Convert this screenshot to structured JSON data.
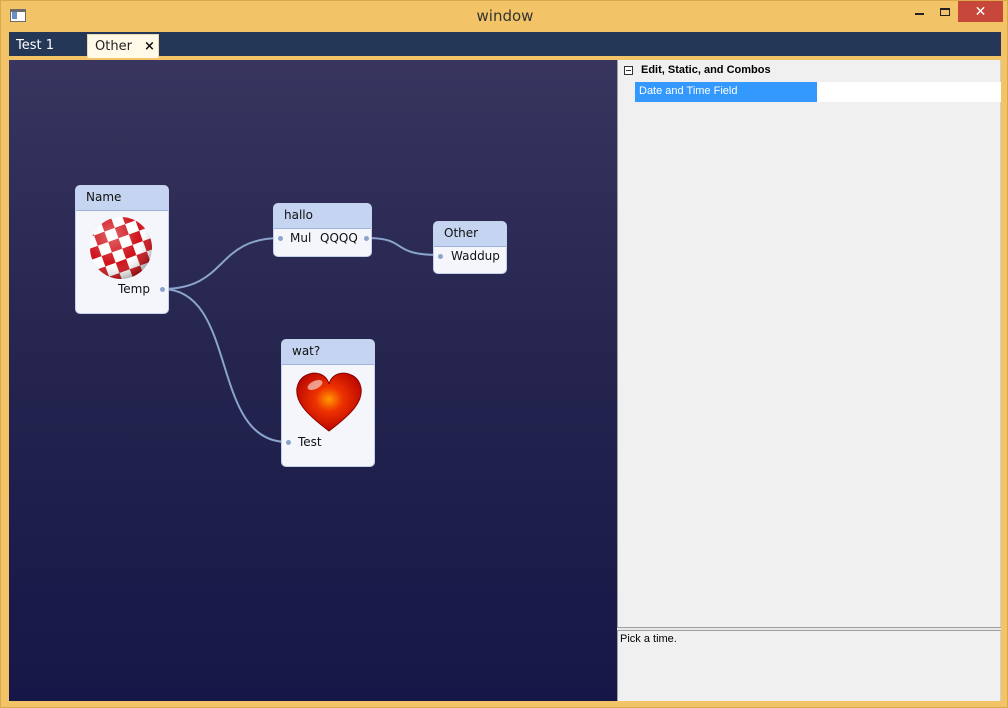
{
  "window": {
    "title": "window"
  },
  "tabs": [
    {
      "label": "Test 1",
      "active": false
    },
    {
      "label": "Other",
      "active": true,
      "close": "×"
    }
  ],
  "nodes": {
    "name_node": {
      "title": "Name",
      "image": "checkered-ball-icon",
      "outputs": [
        "Temp"
      ]
    },
    "hallo_node": {
      "title": "hallo",
      "inputs": [
        "Mul"
      ],
      "outputs": [
        "QQQQ"
      ]
    },
    "other_node": {
      "title": "Other",
      "inputs": [
        "Waddup"
      ]
    },
    "wat_node": {
      "title": "wat?",
      "image": "heart-icon",
      "inputs": [
        "Test"
      ]
    }
  },
  "links": [
    {
      "from": "Name.Temp",
      "to": "hallo.Mul"
    },
    {
      "from": "hallo.QQQQ",
      "to": "Other.Waddup"
    },
    {
      "from": "Name.Temp",
      "to": "wat?.Test"
    }
  ],
  "property_grid": {
    "category": "Edit, Static, and Combos",
    "rows": [
      {
        "name": "Date and Time Field",
        "value": "",
        "selected": true
      }
    ],
    "help_text": "Pick a time."
  },
  "colors": {
    "selection": "#3399ff",
    "frame": "#f2c467",
    "tabbar": "#253756",
    "node_header": "#c5d4f1",
    "link": "#8aa4cc"
  }
}
